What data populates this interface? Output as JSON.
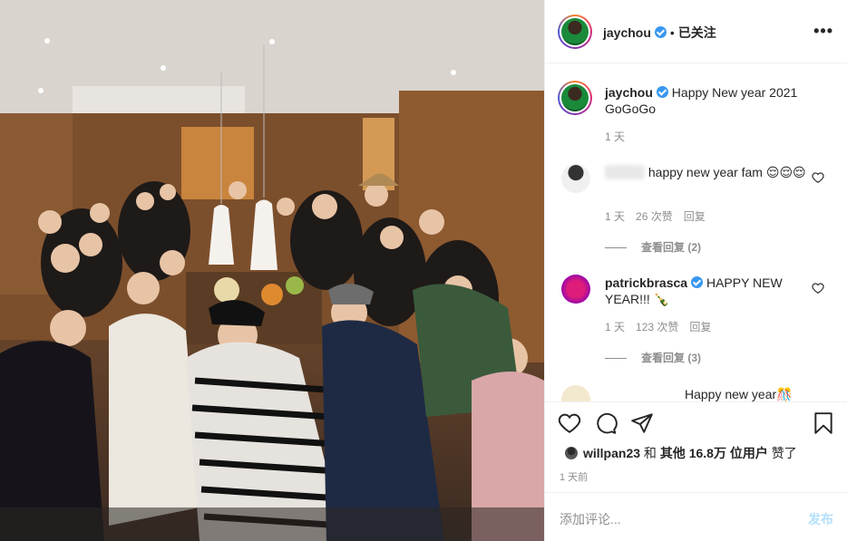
{
  "header": {
    "username": "jaychou",
    "separator": "•",
    "follow_status": "已关注",
    "more_icon": "more-horizontal-icon"
  },
  "caption": {
    "username": "jaychou",
    "text": "Happy New year 2021 GoGoGo",
    "time": "1 天"
  },
  "comments": [
    {
      "username_hidden": true,
      "text": "happy new year fam 😌😌😌",
      "time": "1 天",
      "likes": "26 次赞",
      "reply": "回复",
      "view_replies": "查看回复 (2)"
    },
    {
      "username": "patrickbrasca",
      "text": "HAPPY NEW YEAR!!! 🍾",
      "time": "1 天",
      "likes": "123 次赞",
      "reply": "回复",
      "view_replies": "查看回复 (3)"
    },
    {
      "text": "Happy new year🎊"
    }
  ],
  "actions": {
    "icons": [
      "heart-icon",
      "comment-icon",
      "share-icon",
      "bookmark-icon"
    ],
    "liked_by_user": "willpan23",
    "liked_by_middle": "和",
    "liked_by_others": "其他 16.8万 位用户",
    "liked_by_suffix": "赞了",
    "time_ago": "1 天前"
  },
  "add_comment": {
    "placeholder": "添加评论...",
    "post_label": "发布"
  }
}
